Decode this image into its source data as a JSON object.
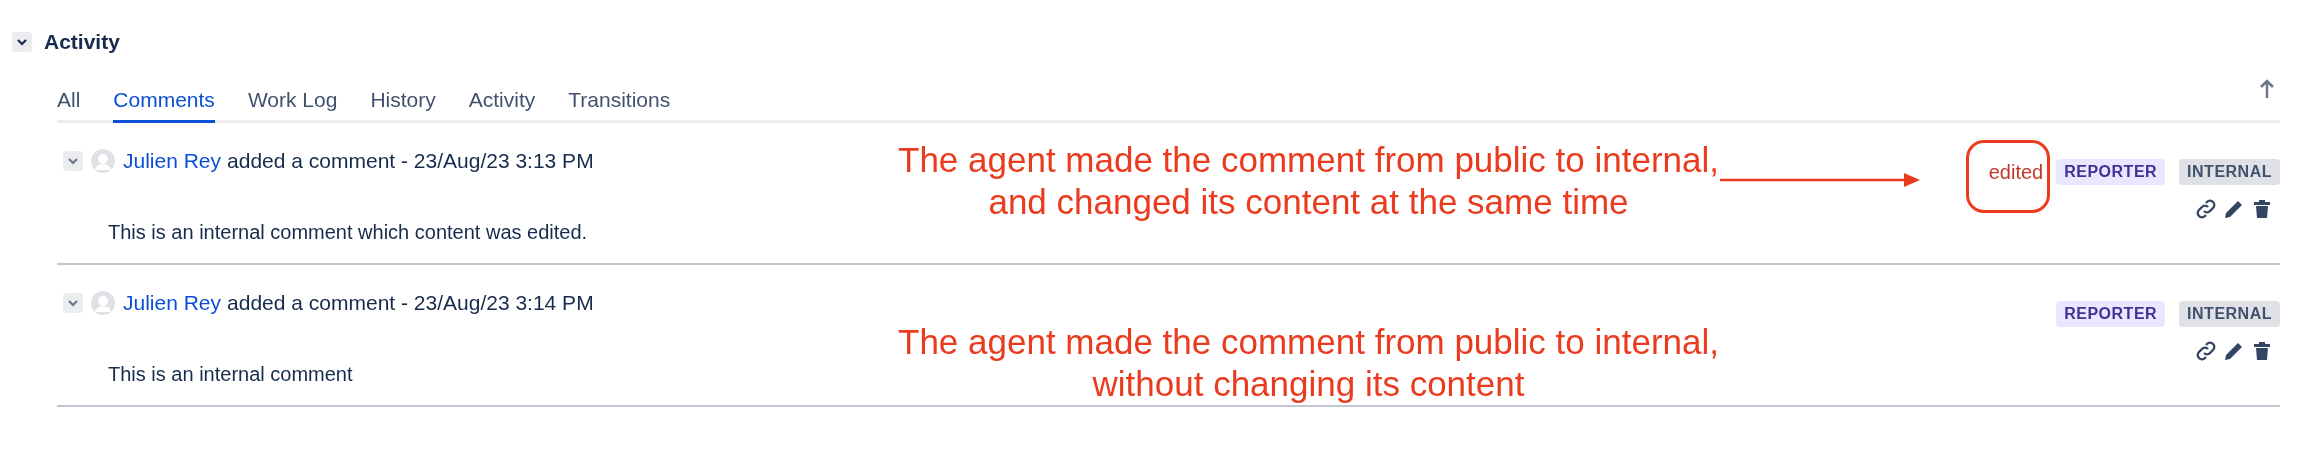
{
  "section": {
    "title": "Activity",
    "expanded": true
  },
  "tabs": [
    {
      "label": "All",
      "selected": false
    },
    {
      "label": "Comments",
      "selected": true
    },
    {
      "label": "Work Log",
      "selected": false
    },
    {
      "label": "History",
      "selected": false
    },
    {
      "label": "Activity",
      "selected": false
    },
    {
      "label": "Transitions",
      "selected": false
    }
  ],
  "comments": [
    {
      "author": "Julien Rey",
      "action": "added a comment - 23/Aug/23 3:13 PM",
      "body": "This is an internal comment which content was edited.",
      "edited_label": "edited",
      "badges": [
        "REPORTER",
        "INTERNAL"
      ],
      "annotation": [
        "The agent made the comment from public to internal,",
        "and changed its content at the same time"
      ],
      "arrow": true
    },
    {
      "author": "Julien Rey",
      "action": "added a comment - 23/Aug/23 3:14 PM",
      "body": "This is an internal comment",
      "badges": [
        "REPORTER",
        "INTERNAL"
      ],
      "annotation": [
        "The agent made the comment from public to internal,",
        "without changing its content"
      ],
      "arrow": false
    }
  ]
}
